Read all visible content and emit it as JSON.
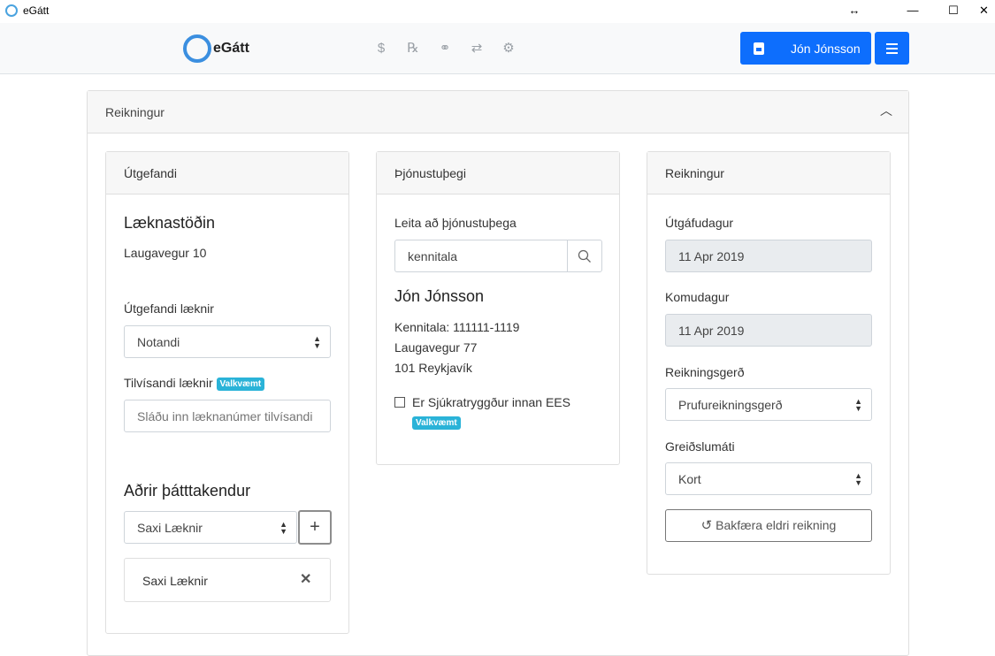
{
  "window": {
    "title": "eGátt",
    "controls": [
      "↔",
      "—",
      "☐",
      "✕"
    ]
  },
  "navbar": {
    "brand": "eGátt",
    "icons": [
      "dollar-icon",
      "prescription-icon",
      "pills-icon",
      "transfer-icon",
      "settings-icon"
    ],
    "user_name": "Jón Jónsson"
  },
  "outer_card": {
    "title": "Reikningur"
  },
  "issuer": {
    "header": "Útgefandi",
    "clinic_name": "Læknastöðin",
    "clinic_address": "Laugavegur 10",
    "issuing_doctor_label": "Útgefandi læknir",
    "issuing_doctor_value": "Notandi",
    "referring_doctor_label": "Tilvísandi læknir",
    "optional_badge": "Valkvæmt",
    "referring_doctor_placeholder": "Sláðu inn læknanúmer tilvísandi",
    "participants_title": "Aðrir þátttakendur",
    "participant_select_value": "Saxi Læknir",
    "add_icon": "+",
    "participant_item": "Saxi Læknir",
    "remove_icon": "✕"
  },
  "recipient": {
    "header": "Þjónustuþegi",
    "search_label": "Leita að þjónustuþega",
    "search_value": "kennitala",
    "name": "Jón Jónsson",
    "kennitala": "Kennitala: 111111-1119",
    "address1": "Laugavegur 77",
    "address2": "101 Reykjavík",
    "insured_label": "Er Sjúkratryggður innan EES",
    "optional_badge": "Valkvæmt"
  },
  "invoice": {
    "header": "Reikningur",
    "issue_date_label": "Útgáfudagur",
    "issue_date": "11 Apr 2019",
    "arrival_date_label": "Komudagur",
    "arrival_date": "11 Apr 2019",
    "invoice_type_label": "Reikningsgerð",
    "invoice_type_value": "Prufureikningsgerð",
    "payment_method_label": "Greiðslumáti",
    "payment_method_value": "Kort",
    "restore_button": "Bakfæra eldri reikning"
  }
}
